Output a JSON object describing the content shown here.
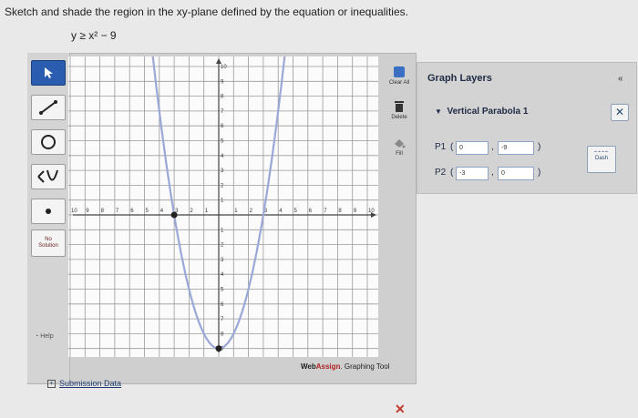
{
  "instructions": "Sketch and shade the region in the xy-plane defined by the equation or inequalities.",
  "equation": "y ≥ x² − 9",
  "toolbar": {
    "no_solution_line1": "No",
    "no_solution_line2": "Solution",
    "help": "Help"
  },
  "side_buttons": {
    "clear_all": "Clear All",
    "delete": "Delete",
    "fill": "Fill"
  },
  "graph": {
    "x_ticks": [
      "10",
      "9",
      "8",
      "7",
      "6",
      "5",
      "4",
      "3",
      "2",
      "1",
      "1",
      "2",
      "3",
      "4",
      "5",
      "6",
      "7",
      "8",
      "9",
      "10"
    ],
    "y_ticks": [
      "10",
      "9",
      "8",
      "7",
      "6",
      "5",
      "4",
      "3",
      "2",
      "1",
      "1",
      "2",
      "3",
      "4",
      "5",
      "6",
      "7",
      "8",
      "9",
      "10"
    ],
    "xlim": [
      -10,
      10
    ],
    "ylim": [
      -10,
      10
    ],
    "curve": "parabola",
    "points": [
      [
        0,
        -9
      ],
      [
        -3,
        0
      ]
    ]
  },
  "brand": {
    "web": "Web",
    "assign": "Assign",
    "suffix": ". Graphing Tool"
  },
  "layers": {
    "title": "Graph Layers",
    "layer_name": "Vertical Parabola 1",
    "p1_label": "P1",
    "p1_x": "0",
    "p1_y": "-9",
    "p2_label": "P2",
    "p2_x": "-3",
    "p2_y": "0",
    "dash_label": "Dash"
  },
  "submission": "Submission Data",
  "colors": {
    "curve": "#9aa8d8",
    "point": "#222222",
    "tool_selected": "#2a5db0"
  }
}
